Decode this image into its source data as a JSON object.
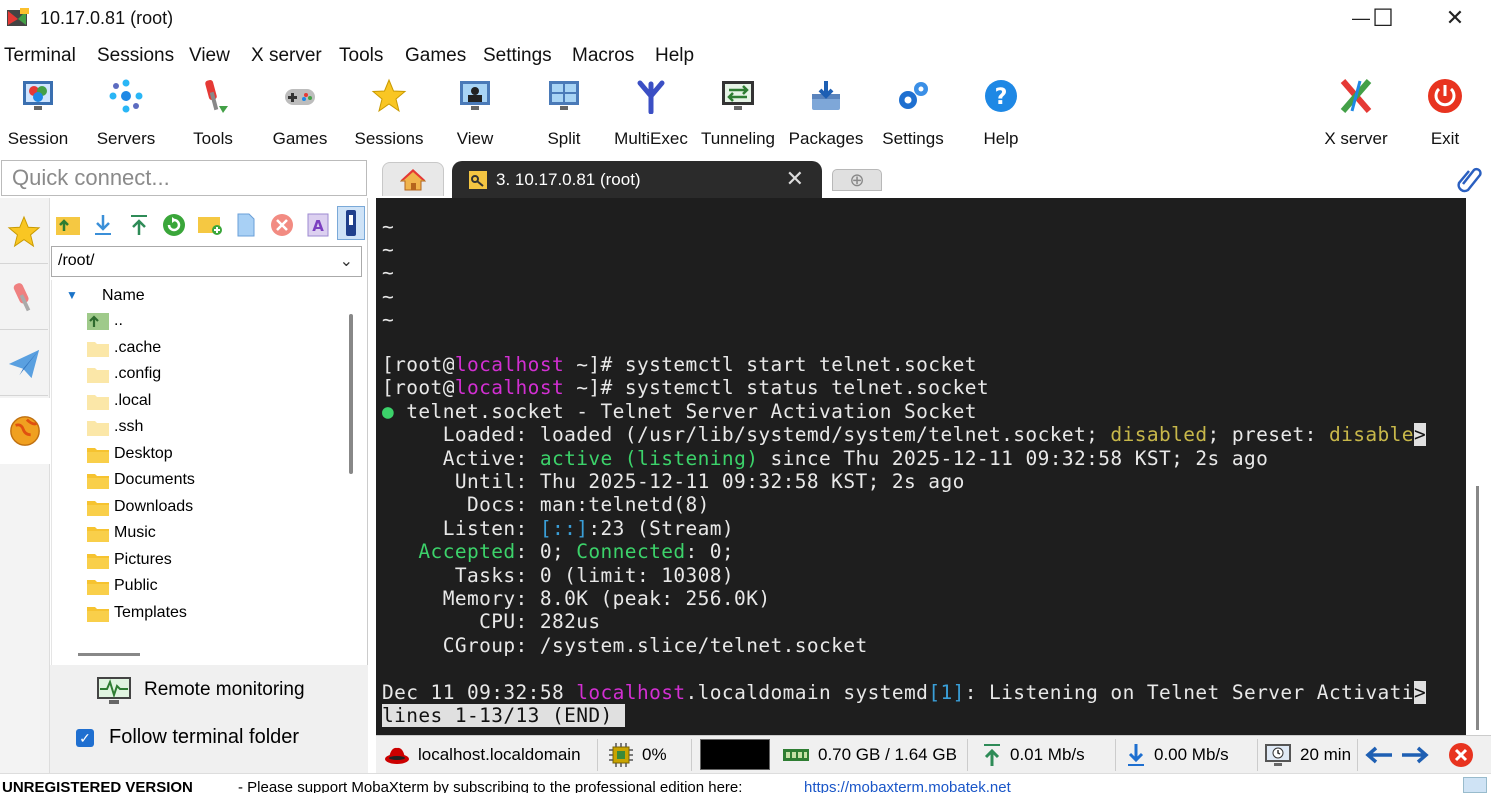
{
  "window": {
    "title": "10.17.0.81 (root)",
    "minimize_glyph": "—",
    "maximize_glyph": "☐",
    "close_glyph": "✕"
  },
  "menu": [
    "Terminal",
    "Sessions",
    "View",
    "X server",
    "Tools",
    "Games",
    "Settings",
    "Macros",
    "Help"
  ],
  "toolbar": {
    "session": "Session",
    "servers": "Servers",
    "tools": "Tools",
    "games": "Games",
    "sessions": "Sessions",
    "view": "View",
    "split": "Split",
    "multiexec": "MultiExec",
    "tunneling": "Tunneling",
    "packages": "Packages",
    "settings": "Settings",
    "help": "Help",
    "xserver": "X server",
    "exit": "Exit"
  },
  "quick_connect": {
    "placeholder": "Quick connect..."
  },
  "tabs": {
    "session_tab_label": "3. 10.17.0.81 (root)",
    "close_glyph": "✕",
    "new_tab_glyph": "⊕"
  },
  "sftp": {
    "path": "/root/",
    "column_name": "Name",
    "sort_glyph": "▼",
    "files": [
      {
        "name": "..",
        "type": "parent"
      },
      {
        "name": ".cache",
        "type": "hidden"
      },
      {
        "name": ".config",
        "type": "hidden"
      },
      {
        "name": ".local",
        "type": "hidden"
      },
      {
        "name": ".ssh",
        "type": "hidden"
      },
      {
        "name": "Desktop",
        "type": "folder"
      },
      {
        "name": "Documents",
        "type": "folder"
      },
      {
        "name": "Downloads",
        "type": "folder"
      },
      {
        "name": "Music",
        "type": "folder"
      },
      {
        "name": "Pictures",
        "type": "folder"
      },
      {
        "name": "Public",
        "type": "folder"
      },
      {
        "name": "Templates",
        "type": "folder"
      }
    ],
    "remote_monitoring": "Remote monitoring",
    "follow_terminal_folder": "Follow terminal folder",
    "follow_checked": true
  },
  "terminal": {
    "tilde": "~",
    "prompt_open": "[root@",
    "prompt_host": "localhost",
    "prompt_close": " ~]# ",
    "cmd1": "systemctl start telnet.socket",
    "cmd2": "systemctl status telnet.socket",
    "bullet": "●",
    "unit_line": " telnet.socket - Telnet Server Activation Socket",
    "loaded_key": "     Loaded: ",
    "loaded_val1": "loaded (/usr/lib/systemd/system/telnet.socket; ",
    "loaded_disabled": "disabled",
    "loaded_val2": "; preset: ",
    "loaded_disable2": "disable",
    "active_key": "     Active: ",
    "active_val": "active (listening)",
    "active_rest": " since Thu 2025-12-11 09:32:58 KST; 2s ago",
    "until_line": "      Until: Thu 2025-12-11 09:32:58 KST; 2s ago",
    "docs_line": "       Docs: man:telnetd(8)",
    "listen_key": "     Listen: ",
    "listen_addr": "[::]",
    "listen_rest": ":23 (Stream)",
    "accepted_key": "   Accepted",
    "accepted_val": ": 0; ",
    "connected_key": "Connected",
    "connected_val": ": 0;",
    "tasks_line": "      Tasks: 0 (limit: 10308)",
    "memory_line": "     Memory: 8.0K (peak: 256.0K)",
    "cpu_line": "        CPU: 282us",
    "cgroup_line": "     CGroup: /system.slice/telnet.socket",
    "log_date": "Dec 11 09:32:58 ",
    "log_host": "localhost",
    "log_mid": ".localdomain systemd",
    "log_pid": "[1]",
    "log_rest": ": Listening on Telnet Server Activati",
    "overflow_marker": ">",
    "pager": "lines 1-13/13 (END)"
  },
  "status": {
    "host": "localhost.localdomain",
    "cpu": "0%",
    "memory": "0.70 GB / 1.64 GB",
    "upload": "0.01 Mb/s",
    "download": "0.00 Mb/s",
    "uptime": "20 min"
  },
  "footer": {
    "unregistered": "UNREGISTERED VERSION",
    "message": "-  Please support MobaXterm by subscribing to the professional edition here:",
    "link": "https://mobaxterm.mobatek.net"
  },
  "colors": {
    "terminal_bg": "#1e1e1e",
    "prompt_host": "#d22fd2",
    "active_green": "#3cd26a",
    "disabled_yellow": "#c8b84a",
    "cyan": "#3a9fd8",
    "exit_red": "#e8331f",
    "help_blue": "#1e88e5"
  }
}
